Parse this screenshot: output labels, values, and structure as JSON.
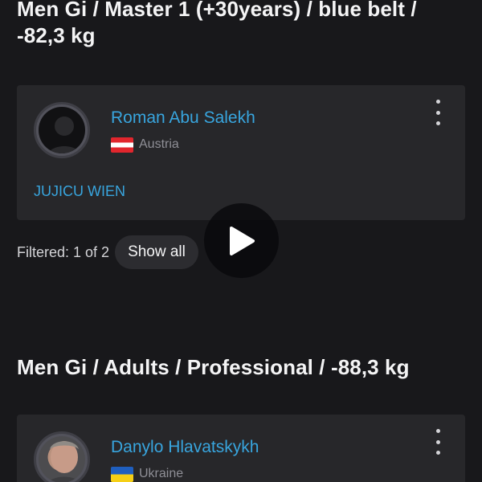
{
  "sections": [
    {
      "title": "Men Gi / Master 1 (+30years) / blue belt / -82,3 kg",
      "athlete": {
        "name": "Roman Abu Salekh",
        "country": "Austria",
        "club": "JUJICU WIEN",
        "avatar": "default-avatar-icon"
      },
      "filter": {
        "text": "Filtered: 1 of 2",
        "button_label": "Show all"
      }
    },
    {
      "title": "Men Gi / Adults / Professional / -88,3 kg",
      "athlete": {
        "name": "Danylo Hlavatskykh",
        "country": "Ukraine",
        "avatar": "profile-photo"
      }
    }
  ],
  "overlay": {
    "icon": "play-icon"
  },
  "colors": {
    "background": "#18181b",
    "card": "#27272a",
    "accent": "#38a5de",
    "muted_text": "#8f8f96"
  }
}
